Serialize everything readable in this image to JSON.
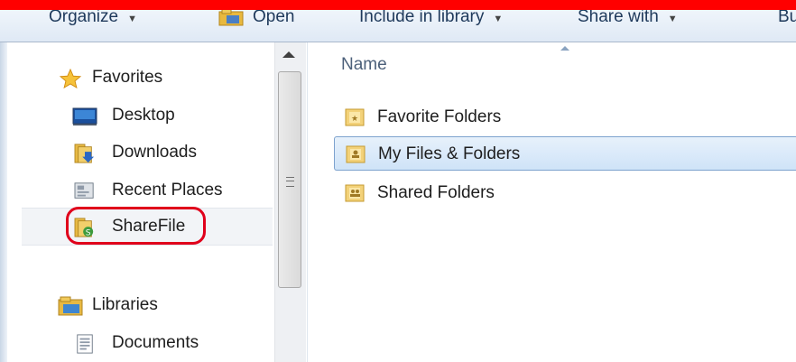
{
  "toolbar": {
    "organize": "Organize",
    "open": "Open",
    "include_in_library": "Include in library",
    "share_with": "Share with",
    "overflow": "Bu",
    "caret": "▼"
  },
  "nav": {
    "favorites_header": "Favorites",
    "items": [
      {
        "label": "Desktop",
        "icon": "desktop-icon"
      },
      {
        "label": "Downloads",
        "icon": "downloads-folder-icon"
      },
      {
        "label": "Recent Places",
        "icon": "recent-places-icon"
      },
      {
        "label": "ShareFile",
        "icon": "sharefile-folder-icon",
        "selected": true
      }
    ],
    "libraries_header": "Libraries",
    "library_items": [
      {
        "label": "Documents",
        "icon": "documents-icon"
      }
    ]
  },
  "content": {
    "column_header": "Name",
    "files": [
      {
        "label": "Favorite Folders",
        "icon": "folder-star-icon"
      },
      {
        "label": "My Files & Folders",
        "icon": "folder-person-icon",
        "selected": true
      },
      {
        "label": "Shared Folders",
        "icon": "folder-shared-icon"
      }
    ]
  },
  "colors": {
    "highlight_ring": "#e0001b",
    "top_bar": "#ff0000",
    "selection_border": "#7da2ce"
  }
}
